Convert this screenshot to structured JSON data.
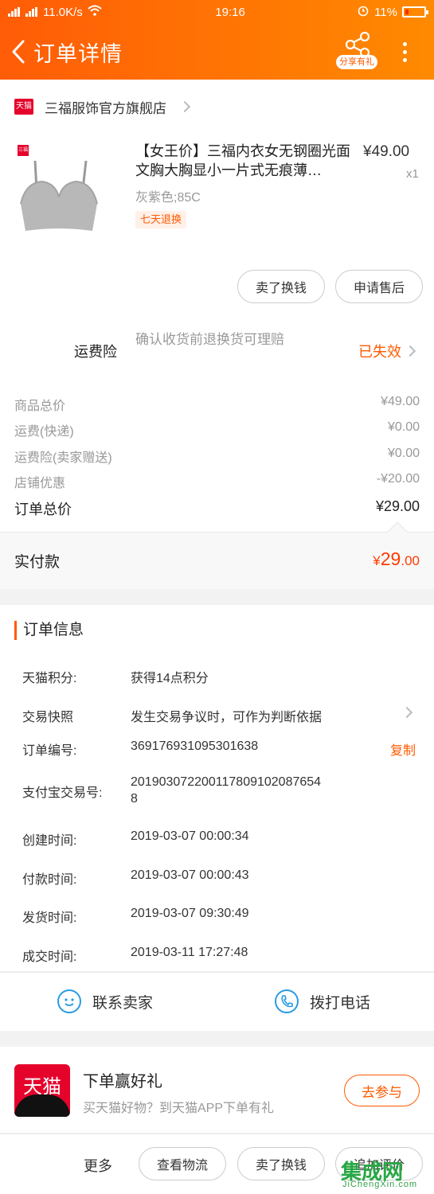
{
  "status_bar": {
    "signal_left": "2G",
    "signal_right": "4G",
    "speed": "11.0K/s",
    "time": "19:16",
    "battery": "11%"
  },
  "nav": {
    "title": "订单详情",
    "share_label": "分享有礼"
  },
  "store": {
    "badge": "天猫",
    "name": "三福服饰官方旗舰店"
  },
  "product": {
    "title": "【女王价】三福内衣女无钢圈光面文胸大胸显小一片式无痕薄…",
    "price": "¥49.00",
    "quantity": "x1",
    "spec": "灰紫色;85C",
    "tag": "七天退换",
    "thumb_badge": "三福"
  },
  "actions": {
    "exchange": "卖了换钱",
    "after_sale": "申请售后"
  },
  "insurance": {
    "label": "运费险",
    "description": "确认收货前退换货可理赔",
    "status": "已失效"
  },
  "price_breakdown": {
    "rows": [
      {
        "label": "商品总价",
        "value": "¥49.00"
      },
      {
        "label": "运费(快递)",
        "value": "¥0.00"
      },
      {
        "label": "运费险(卖家赠送)",
        "value": "¥0.00"
      },
      {
        "label": "店铺优惠",
        "value": "-¥20.00"
      }
    ],
    "total_label": "订单总价",
    "total_value": "¥29.00",
    "paid_label": "实付款",
    "paid_currency": "¥",
    "paid_int": "29",
    "paid_dec": ".00"
  },
  "order_info": {
    "title": "订单信息",
    "rows": [
      {
        "label": "天猫积分:",
        "value": "获得14点积分"
      },
      {
        "label": "交易快照",
        "value": "发生交易争议时，可作为判断依据"
      },
      {
        "label": "订单编号:",
        "value": "369176931095301638"
      },
      {
        "label": "支付宝交易号:",
        "value": "201903072200117809102087654\n8"
      },
      {
        "label": "创建时间:",
        "value": "2019-03-07 00:00:34"
      },
      {
        "label": "付款时间:",
        "value": "2019-03-07 00:00:43"
      },
      {
        "label": "发货时间:",
        "value": "2019-03-07 09:30:49"
      },
      {
        "label": "成交时间:",
        "value": "2019-03-11 17:27:48"
      }
    ],
    "copy_label": "复制"
  },
  "contact": {
    "seller": "联系卖家",
    "phone": "拨打电话"
  },
  "promo": {
    "logo_text": "天猫",
    "title": "下单赢好礼",
    "subtitle": "买天猫好物？到天猫APP下单有礼",
    "button": "去参与"
  },
  "bottom_bar": {
    "more": "更多",
    "logistics": "查看物流",
    "exchange": "卖了换钱",
    "review": "追加评价"
  },
  "watermark": {
    "main": "集成网",
    "url": "JiChengXin.com"
  },
  "colors": {
    "accent": "#ff5a00",
    "price_red": "#ff3b00",
    "tmall_red": "#e5032c",
    "link_blue": "#2a9be4"
  }
}
